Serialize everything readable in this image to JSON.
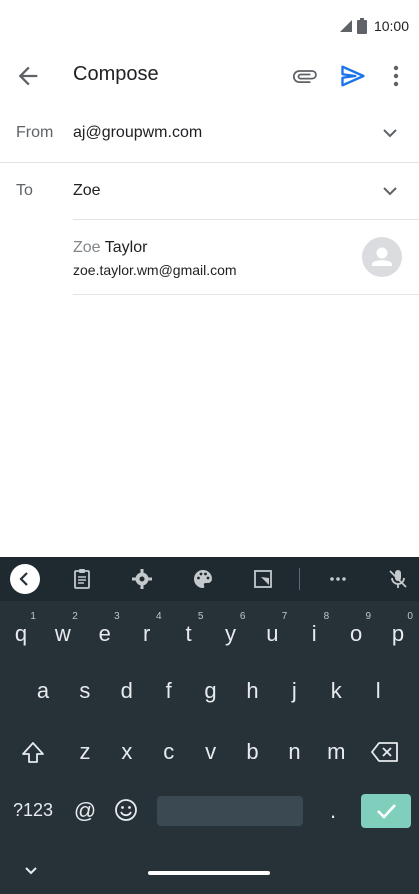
{
  "status_bar": {
    "time": "10:00",
    "signal_icon": "signal-icon",
    "battery_icon": "battery-icon"
  },
  "app_bar": {
    "title": "Compose",
    "back_icon": "arrow-left-icon",
    "attach_icon": "paperclip-icon",
    "send_icon": "send-icon",
    "more_icon": "more-vert-icon",
    "accent": "#1a73e8"
  },
  "from": {
    "label": "From",
    "value": "aj@groupwm.com"
  },
  "to": {
    "label": "To",
    "value": "Zoe"
  },
  "suggestion": {
    "name_typed": "Zoe",
    "name_rest": " Taylor",
    "email": "zoe.taylor.wm@gmail.com"
  },
  "keyboard": {
    "toolbar_icons": [
      "chevron-left-icon",
      "clipboard-icon",
      "gear-icon",
      "palette-icon",
      "resize-icon",
      "more-horiz-icon",
      "mic-off-icon"
    ],
    "row1": [
      {
        "ch": "q",
        "hint": "1"
      },
      {
        "ch": "w",
        "hint": "2"
      },
      {
        "ch": "e",
        "hint": "3"
      },
      {
        "ch": "r",
        "hint": "4"
      },
      {
        "ch": "t",
        "hint": "5"
      },
      {
        "ch": "y",
        "hint": "6"
      },
      {
        "ch": "u",
        "hint": "7"
      },
      {
        "ch": "i",
        "hint": "8"
      },
      {
        "ch": "o",
        "hint": "9"
      },
      {
        "ch": "p",
        "hint": "0"
      }
    ],
    "row2": [
      "a",
      "s",
      "d",
      "f",
      "g",
      "h",
      "j",
      "k",
      "l"
    ],
    "row3": [
      "z",
      "x",
      "c",
      "v",
      "b",
      "n",
      "m"
    ],
    "symbols_label": "?123",
    "at_label": "@",
    "period_label": ".",
    "colors": {
      "background": "#263238",
      "enter": "#7fcfbc"
    }
  }
}
